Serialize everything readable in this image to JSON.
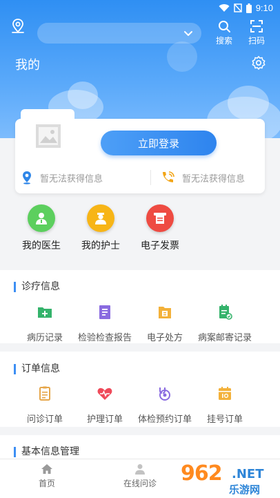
{
  "status_bar": {
    "time": "9:10"
  },
  "header": {
    "title": "我的",
    "search_label": "搜索",
    "scan_label": "扫码"
  },
  "profile": {
    "login_button": "立即登录",
    "info_left": "暂无法获得信息",
    "info_right": "暂无法获得信息"
  },
  "quick_entries": [
    {
      "label": "我的医生",
      "icon": "doctor-icon",
      "color": "#5ccf5e"
    },
    {
      "label": "我的护士",
      "icon": "nurse-icon",
      "color": "#f7b517"
    },
    {
      "label": "电子发票",
      "icon": "invoice-icon",
      "color": "#ee4b42"
    }
  ],
  "sections": {
    "medical": {
      "title": "诊疗信息",
      "items": [
        {
          "label": "病历记录",
          "icon": "folder-plus-icon"
        },
        {
          "label": "检验检查报告",
          "icon": "report-icon"
        },
        {
          "label": "电子处方",
          "icon": "prescription-icon"
        },
        {
          "label": "病案邮寄记录",
          "icon": "mail-record-icon"
        }
      ]
    },
    "orders": {
      "title": "订单信息",
      "items": [
        {
          "label": "问诊订单",
          "icon": "consult-order-icon"
        },
        {
          "label": "护理订单",
          "icon": "care-order-icon"
        },
        {
          "label": "体检预约订单",
          "icon": "checkup-order-icon"
        },
        {
          "label": "挂号订单",
          "icon": "register-order-icon"
        }
      ]
    },
    "basic": {
      "title": "基本信息管理"
    }
  },
  "bottom_nav": [
    {
      "label": "首页",
      "icon": "home-icon"
    },
    {
      "label": "在线问诊",
      "icon": "consult-icon"
    }
  ],
  "watermark": {
    "number": "962",
    "suffix": ".NET",
    "text": "乐游网"
  }
}
